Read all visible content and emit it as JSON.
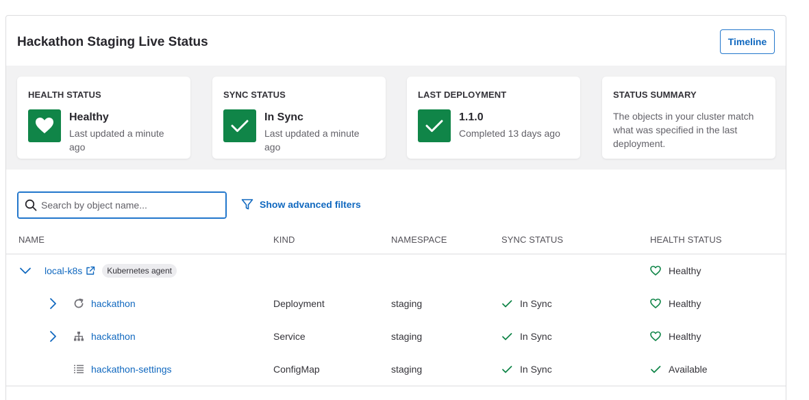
{
  "header": {
    "title": "Hackathon Staging Live Status",
    "timeline_label": "Timeline"
  },
  "cards": [
    {
      "label": "HEALTH STATUS",
      "value": "Healthy",
      "sub": "Last updated a minute ago",
      "icon": "heart-icon"
    },
    {
      "label": "SYNC STATUS",
      "value": "In Sync",
      "sub": "Last updated a minute ago",
      "icon": "check-icon"
    },
    {
      "label": "LAST DEPLOYMENT",
      "value": "1.1.0",
      "sub": "Completed 13 days ago",
      "icon": "check-icon"
    },
    {
      "label": "STATUS SUMMARY",
      "description": "The objects in your cluster match what was specified in the last deployment."
    }
  ],
  "search": {
    "placeholder": "Search by object name...",
    "value": ""
  },
  "filters": {
    "label": "Show advanced filters"
  },
  "table": {
    "columns": [
      "NAME",
      "KIND",
      "NAMESPACE",
      "SYNC STATUS",
      "HEALTH STATUS"
    ],
    "group": {
      "name": "local-k8s",
      "badge": "Kubernetes agent",
      "health": "Healthy"
    },
    "rows": [
      {
        "name": "hackathon",
        "kind": "Deployment",
        "namespace": "staging",
        "sync": "In Sync",
        "health": "Healthy",
        "icon": "deployment-icon"
      },
      {
        "name": "hackathon",
        "kind": "Service",
        "namespace": "staging",
        "sync": "In Sync",
        "health": "Healthy",
        "icon": "service-icon"
      },
      {
        "name": "hackathon-settings",
        "kind": "ConfigMap",
        "namespace": "staging",
        "sync": "In Sync",
        "health": "Available",
        "icon": "configmap-icon"
      }
    ]
  },
  "colors": {
    "accent": "#1068bf",
    "success": "#108548",
    "band": "#f2f2f3"
  }
}
